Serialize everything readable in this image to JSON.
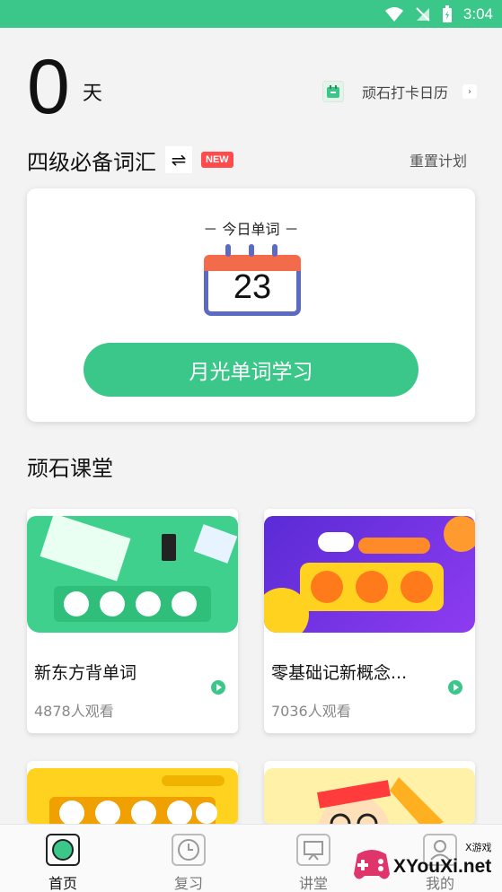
{
  "status_bar": {
    "time": "3:04",
    "accent": "#3cc78a"
  },
  "streak": {
    "days": "0",
    "unit": "天"
  },
  "checkin": {
    "label": "顽石打卡日历",
    "icon": "calendar-icon"
  },
  "wordbook": {
    "title": "四级必备词汇",
    "new_badge": "NEW",
    "reset_label": "重置计划"
  },
  "today": {
    "label": "－ 今日单词 －",
    "count": "23",
    "study_button": "月光单词学习"
  },
  "section": {
    "title": "顽石课堂"
  },
  "courses": [
    {
      "banner": "",
      "title": "新东方背单词",
      "views": "4878人观看"
    },
    {
      "banner": "",
      "title": "零基础记新概念...",
      "views": "7036人观看"
    },
    {
      "banner": "",
      "title": "",
      "views": ""
    },
    {
      "banner": "",
      "title": "",
      "views": ""
    }
  ],
  "tabs": [
    {
      "label": "首页",
      "icon": "home-icon",
      "active": true
    },
    {
      "label": "复习",
      "icon": "clock-icon",
      "active": false
    },
    {
      "label": "讲堂",
      "icon": "presentation-icon",
      "active": false
    },
    {
      "label": "我的",
      "icon": "profile-icon",
      "active": false
    }
  ],
  "watermark": {
    "brand": "XYouXi.net",
    "sub": "X游戏"
  }
}
